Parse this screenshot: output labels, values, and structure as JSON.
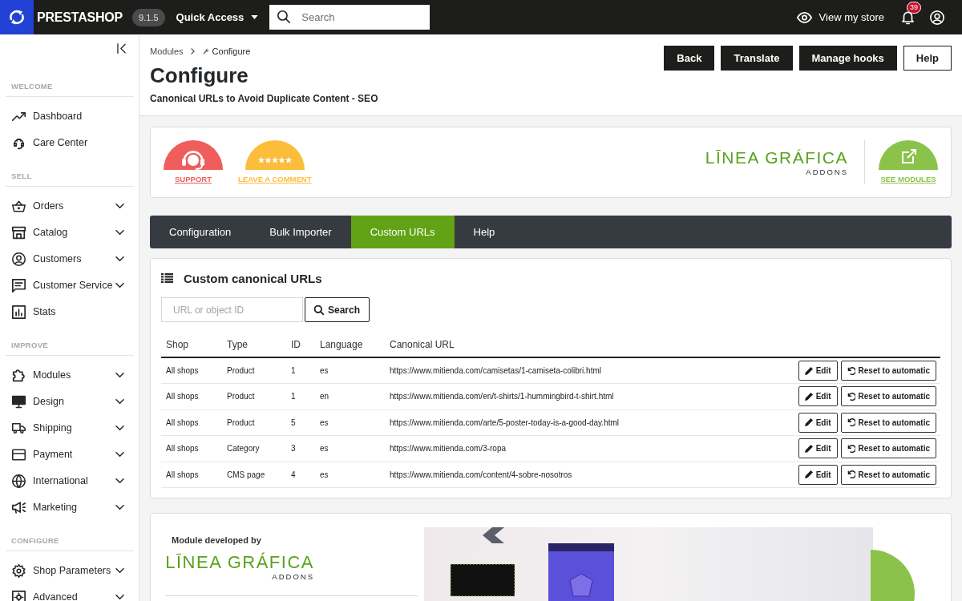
{
  "topbar": {
    "logo": "PRESTASHOP",
    "version": "9.1.5",
    "quick_access": "Quick Access",
    "search": {
      "placeholder": "Search"
    },
    "view_store": "View my store",
    "notification_count": "39"
  },
  "sidebar": {
    "sections": [
      {
        "title": "WELCOME",
        "items": [
          {
            "label": "Dashboard",
            "expandable": false
          },
          {
            "label": "Care Center",
            "expandable": false
          }
        ]
      },
      {
        "title": "SELL",
        "items": [
          {
            "label": "Orders",
            "expandable": true
          },
          {
            "label": "Catalog",
            "expandable": true
          },
          {
            "label": "Customers",
            "expandable": true
          },
          {
            "label": "Customer Service",
            "expandable": true
          },
          {
            "label": "Stats",
            "expandable": false
          }
        ]
      },
      {
        "title": "IMPROVE",
        "items": [
          {
            "label": "Modules",
            "expandable": true
          },
          {
            "label": "Design",
            "expandable": true
          },
          {
            "label": "Shipping",
            "expandable": true
          },
          {
            "label": "Payment",
            "expandable": true
          },
          {
            "label": "International",
            "expandable": true
          },
          {
            "label": "Marketing",
            "expandable": true
          }
        ]
      },
      {
        "title": "CONFIGURE",
        "items": [
          {
            "label": "Shop Parameters",
            "expandable": true
          },
          {
            "label": "Advanced",
            "expandable": true
          }
        ]
      }
    ]
  },
  "header": {
    "breadcrumbs": [
      "Modules",
      "Configure"
    ],
    "title": "Configure",
    "subtitle": "Canonical URLs to Avoid Duplicate Content - SEO",
    "buttons": [
      {
        "label": "Back",
        "kind": "dark"
      },
      {
        "label": "Translate",
        "kind": "dark"
      },
      {
        "label": "Manage hooks",
        "kind": "dark"
      },
      {
        "label": "Help",
        "kind": "light"
      }
    ]
  },
  "module_banner": {
    "links": [
      {
        "label": "SUPPORT",
        "kind": "support",
        "color": "#ef5d5d"
      },
      {
        "label": "LEAVE A COMMENT",
        "kind": "review",
        "color": "#fcbd3b"
      }
    ],
    "brand": {
      "name": "LĪNEA GRÁFICA",
      "tagline": "ADDONS"
    },
    "see_modules": "SEE MODULES"
  },
  "tabs": [
    {
      "label": "Configuration",
      "selected": false
    },
    {
      "label": "Bulk Importer",
      "selected": false
    },
    {
      "label": "Custom URLs",
      "selected": true
    },
    {
      "label": "Help",
      "selected": false
    }
  ],
  "urls_panel": {
    "title": "Custom canonical URLs",
    "search": {
      "placeholder": "URL or object ID",
      "button": "Search"
    },
    "table": {
      "columns": [
        "Shop",
        "Type",
        "ID",
        "Language",
        "Canonical URL"
      ],
      "rows": [
        {
          "cells": [
            "All shops",
            "Product",
            "1",
            "es",
            "https://www.mitienda.com/camisetas/1-camiseta-colibri.html"
          ],
          "actions": [
            {
              "kind": "edit",
              "label": "Edit"
            },
            {
              "kind": "reset",
              "label": "Reset to automatic"
            }
          ]
        },
        {
          "cells": [
            "All shops",
            "Product",
            "1",
            "en",
            "https://www.mitienda.com/en/t-shirts/1-hummingbird-t-shirt.html"
          ],
          "actions": [
            {
              "kind": "edit",
              "label": "Edit"
            },
            {
              "kind": "reset",
              "label": "Reset to automatic"
            }
          ]
        },
        {
          "cells": [
            "All shops",
            "Product",
            "5",
            "es",
            "https://www.mitienda.com/arte/5-poster-today-is-a-good-day.html"
          ],
          "actions": [
            {
              "kind": "edit",
              "label": "Edit"
            },
            {
              "kind": "reset",
              "label": "Reset to automatic"
            }
          ]
        },
        {
          "cells": [
            "All shops",
            "Category",
            "3",
            "es",
            "https://www.mitienda.com/3-ropa"
          ],
          "actions": [
            {
              "kind": "edit",
              "label": "Edit"
            },
            {
              "kind": "reset",
              "label": "Reset to automatic"
            }
          ]
        },
        {
          "cells": [
            "All shops",
            "CMS page",
            "4",
            "es",
            "https://www.mitienda.com/content/4-sobre-nosotros"
          ],
          "actions": [
            {
              "kind": "edit",
              "label": "Edit"
            },
            {
              "kind": "reset",
              "label": "Reset to automatic"
            }
          ]
        }
      ]
    }
  },
  "developer_card": {
    "caption": "Module developed by",
    "brand": {
      "name": "LĪNEA GRÁFICA",
      "tagline": "ADDONS"
    }
  }
}
